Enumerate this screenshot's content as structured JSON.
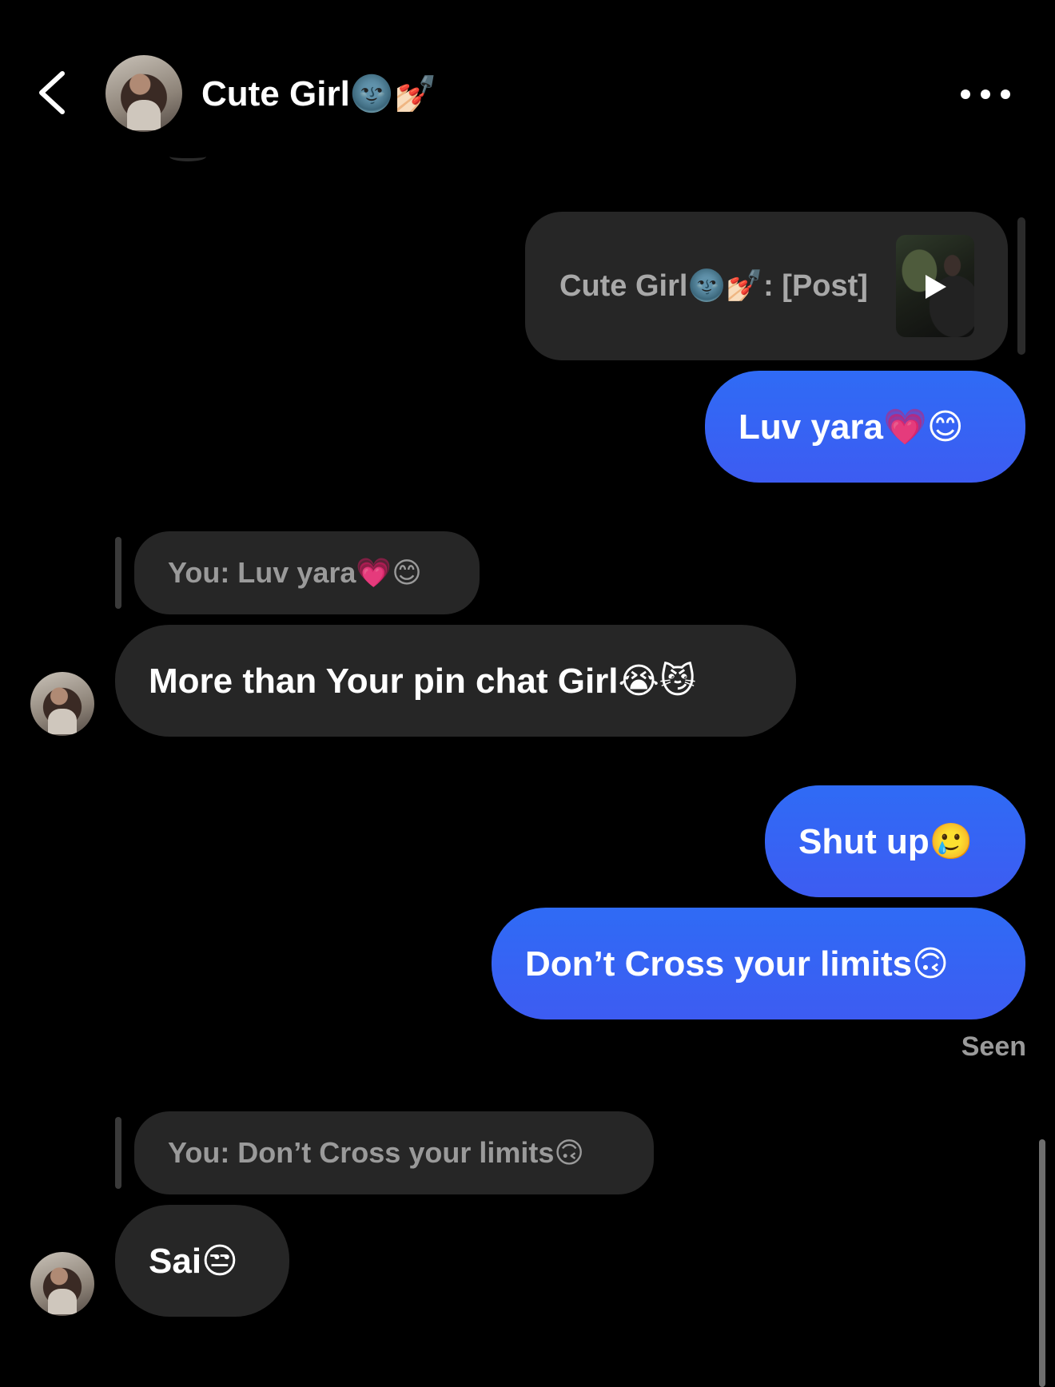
{
  "header": {
    "title": "Cute Girl🌚💅🏻",
    "back_icon": "chevron-left-icon",
    "more_icon": "more-horizontal-icon"
  },
  "messages": [
    {
      "kind": "shared-post",
      "label": "Cute Girl🌚💅🏻: [Post]",
      "icon": "play-icon"
    },
    {
      "kind": "sent",
      "text": "Luv yara💗😊"
    },
    {
      "kind": "received-reply",
      "quote": "You: Luv yara💗😊",
      "text": "More than Your pin chat Girl😭😼"
    },
    {
      "kind": "sent",
      "text": "Shut up🥲"
    },
    {
      "kind": "sent",
      "text": "Don’t Cross your limits🙃"
    },
    {
      "kind": "status",
      "text": "Seen"
    },
    {
      "kind": "received-reply",
      "quote": "You: Don’t Cross your limits🙃",
      "text": "Sai😒"
    }
  ],
  "colors": {
    "background": "#000000",
    "sent_bubble": "#3366f4",
    "received_bubble": "#262626",
    "muted_text": "#9a9a9a"
  }
}
